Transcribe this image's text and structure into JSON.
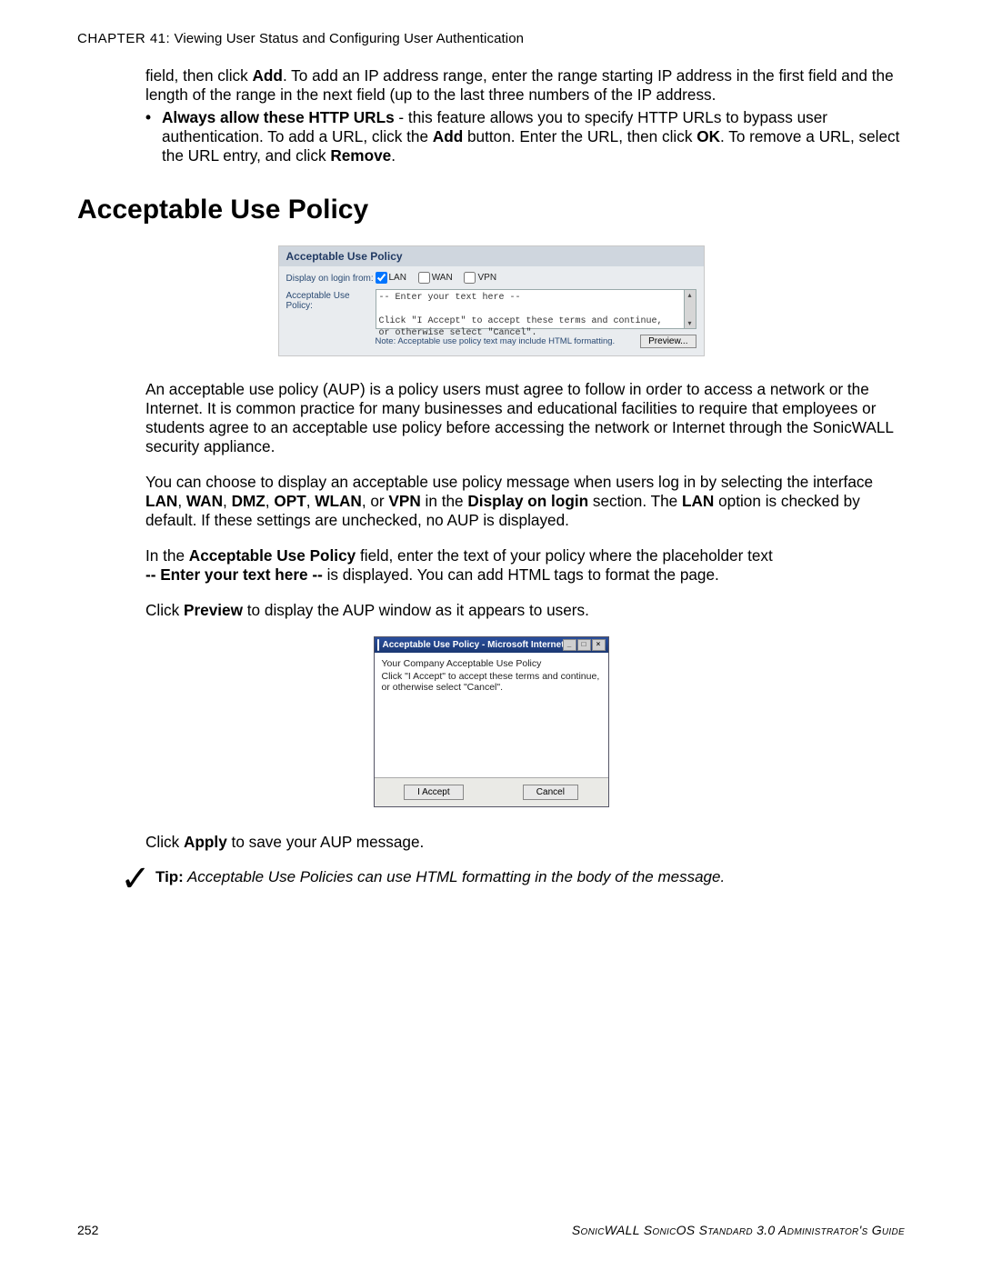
{
  "chapter": {
    "prefix": "CHAPTER 41:",
    "title": "Viewing User Status and Configuring User Authentication"
  },
  "intro_para": {
    "line1_a": "field, then click ",
    "add": "Add",
    "line1_b": ". To add an IP address range, enter the range starting IP address in the first field and the length of the range in the next field (up to the last three numbers of the IP address."
  },
  "bullet1": {
    "lead": "Always allow these HTTP URLs",
    "a": " - this feature allows you to specify HTTP URLs to bypass user authentication. To add a URL, click the ",
    "add": "Add",
    "b": " button. Enter the URL, then click ",
    "ok": "OK",
    "c": ". To remove a URL, select the URL entry, and click ",
    "remove": "Remove",
    "d": "."
  },
  "section_title": "Acceptable Use Policy",
  "aup_panel": {
    "header": "Acceptable Use Policy",
    "label_display": "Display on login from:",
    "chk_lan": "LAN",
    "chk_wan": "WAN",
    "chk_vpn": "VPN",
    "label_policy": "Acceptable Use Policy:",
    "textarea": "-- Enter your text here --\n\nClick \"I Accept\" to accept these terms and continue,\nor otherwise select \"Cancel\".",
    "note": "Note: Acceptable use policy text may include HTML formatting.",
    "preview_btn": "Preview..."
  },
  "para_aup_intro": "An acceptable use policy (AUP) is a policy users must agree to follow in order to access a network or the Internet. It is common practice for many businesses and educational facilities to require that employees or students agree to an acceptable use policy before accessing the network or Internet through the SonicWALL security appliance.",
  "para_choose": {
    "a": "You can choose to display an acceptable use policy message when users log in by selecting the interface ",
    "lan": "LAN",
    "wan": "WAN",
    "dmz": "DMZ",
    "opt": "OPT",
    "wlan": "WLAN",
    "vpn": "VPN",
    "b_in_the": " in the ",
    "display_on_login": "Display on login",
    "b_section": " section. The ",
    "lan2": "LAN",
    "c": " option is checked by default. If these settings are unchecked, no AUP is displayed.",
    "comma": ", ",
    "or": ", or "
  },
  "para_field": {
    "a": "In the ",
    "aup": "Acceptable Use Policy",
    "b": " field, enter the text of your policy where the placeholder text ",
    "placeholder": "-- Enter your text here --",
    "c": " is displayed. You can add HTML tags to format the page."
  },
  "para_click_preview": {
    "a": "Click ",
    "preview": "Preview",
    "b": " to display the AUP window as it appears to users."
  },
  "preview_window": {
    "title": "Acceptable Use Policy - Microsoft Internet Explorer provided by So...",
    "line1": "Your Company Acceptable Use Policy",
    "line2": "Click \"I Accept\" to accept these terms and continue, or otherwise select \"Cancel\".",
    "accept": "I Accept",
    "cancel": "Cancel"
  },
  "para_apply": {
    "a": "Click ",
    "apply": "Apply",
    "b": " to save your AUP message."
  },
  "tip": {
    "label": "Tip:",
    "body": " Acceptable Use Policies can use HTML formatting in the body of the message."
  },
  "footer": {
    "page": "252",
    "guide_a": "SonicWALL SonicOS Standard 3.0 Administrator's Guide"
  }
}
